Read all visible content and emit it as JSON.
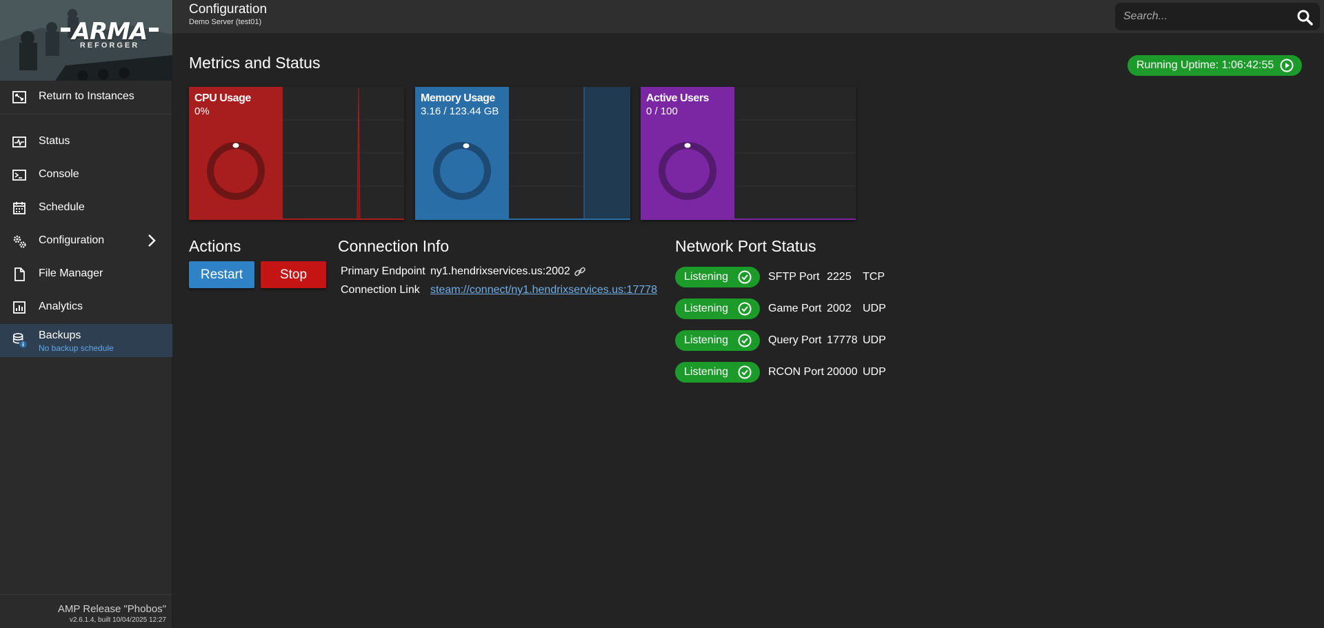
{
  "header": {
    "title": "Configuration",
    "subtitle": "Demo Server (test01)",
    "search_placeholder": "Search..."
  },
  "banner": {
    "logo_main": "ARMA",
    "logo_sub": "REFORGER"
  },
  "sidebar": {
    "items": [
      {
        "label": "Return to Instances",
        "icon": "return-icon"
      },
      {
        "label": "Status",
        "icon": "status-icon"
      },
      {
        "label": "Console",
        "icon": "console-icon"
      },
      {
        "label": "Schedule",
        "icon": "calendar-icon"
      },
      {
        "label": "Configuration",
        "icon": "gears-icon"
      },
      {
        "label": "File Manager",
        "icon": "file-icon"
      },
      {
        "label": "Analytics",
        "icon": "analytics-icon"
      },
      {
        "label": "Backups",
        "icon": "database-icon",
        "sublabel": "No backup schedule"
      }
    ],
    "footer_release": "AMP Release \"Phobos\"",
    "footer_version": "v2.6.1.4, built 10/04/2025 12:27"
  },
  "metrics": {
    "heading": "Metrics and Status",
    "uptime": "Running Uptime: 1:06:42:55",
    "cards": [
      {
        "title": "CPU Usage",
        "value": "0%",
        "color": "#a81d1d",
        "ring": "#6e1515",
        "gauge": 0.0
      },
      {
        "title": "Memory Usage",
        "value": "3.16 / 123.44 GB",
        "color": "#2a6ea8",
        "ring": "#1c4a72",
        "gauge": 0.026
      },
      {
        "title": "Active Users",
        "value": "0 / 100",
        "color": "#7b26a3",
        "ring": "#531a6e",
        "gauge": 0.0
      }
    ]
  },
  "actions": {
    "heading": "Actions",
    "restart_label": "Restart",
    "stop_label": "Stop"
  },
  "connection": {
    "heading": "Connection Info",
    "endpoint_label": "Primary Endpoint",
    "endpoint_value": "ny1.hendrixservices.us:2002",
    "link_label": "Connection Link",
    "link_value": "steam://connect/ny1.hendrixservices.us:17778"
  },
  "ports": {
    "heading": "Network Port Status",
    "rows": [
      {
        "status": "Listening",
        "name": "SFTP Port",
        "port": "2225",
        "protocol": "TCP"
      },
      {
        "status": "Listening",
        "name": "Game Port",
        "port": "2002",
        "protocol": "UDP"
      },
      {
        "status": "Listening",
        "name": "Query Port",
        "port": "17778",
        "protocol": "UDP"
      },
      {
        "status": "Listening",
        "name": "RCON Port",
        "port": "20000",
        "protocol": "UDP"
      }
    ]
  },
  "colors": {
    "accent_green": "#1c9a2a",
    "restart_blue": "#2f82c5",
    "stop_red": "#c41414",
    "link_blue": "#6fb0e8"
  }
}
